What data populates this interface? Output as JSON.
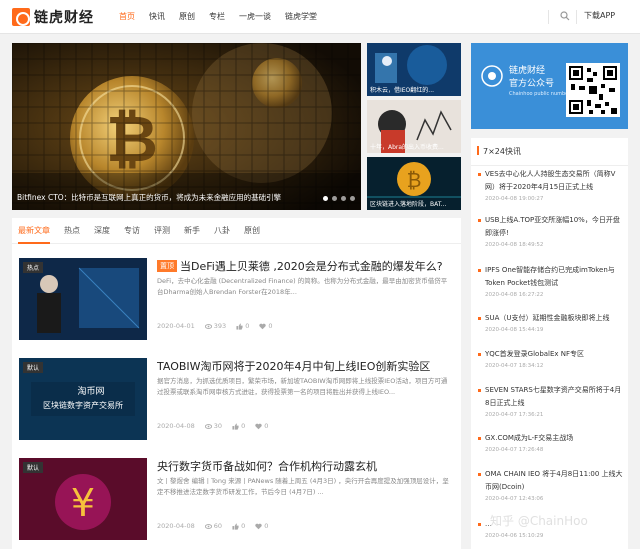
{
  "header": {
    "logo_text": "链虎财经",
    "nav": [
      "首页",
      "快讯",
      "原创",
      "专栏",
      "一虎一谈",
      "链虎学堂"
    ],
    "active_index": 0,
    "app_label": "下载APP",
    "accent": "#ff6a1a"
  },
  "banner": {
    "caption": "Bitfinex CTO：比特币是互联网上真正的货币，将成为未来金融应用的基础引擎",
    "dot_count": 4,
    "active_dot": 0
  },
  "thumbs": [
    {
      "caption": "积木云，借IEO翻红的..."
    },
    {
      "caption": "十年，Abra的出入币收费..."
    },
    {
      "caption": "区块链进入落地阶段，BAT..."
    }
  ],
  "tabs": [
    "最新文章",
    "热点",
    "深度",
    "专访",
    "评测",
    "新手",
    "八卦",
    "原创"
  ],
  "articles": [
    {
      "tag": "热点",
      "hot": "置顶",
      "title": "当DeFi遇上贝莱德 ,2020会是分布式金融的爆发年么?",
      "desc": "DeFi，去中心化金融 (Decentralized Finance) 的简称。也称为分布式金融，最早由加密货币借贷平台Dharma创始人Brendan Forster在2018年...",
      "date": "2020-04-01",
      "views": "393",
      "likes": "0",
      "favs": "0"
    },
    {
      "tag": "默认",
      "hot": "",
      "title": "TAOBIW淘币网将于2020年4月中旬上线IEO创新实验区",
      "desc": "据官方消息，为抓选优质项目，繁荣市场，新加坡TAOBIW淘币网即将上线投票IEO活动，项目方可通过投票或联系淘币网审核方式进驻，获得投票第一名的项目将胜出并获得上线IEO...",
      "date": "2020-04-08",
      "views": "30",
      "likes": "0",
      "favs": "0"
    },
    {
      "tag": "默认",
      "hot": "",
      "title": "央行数字货币备战如何？合作机构行动露玄机",
      "desc": "文丨黎煜舍  编辑丨Tong 来源丨PANews 随着上周五 (4月3日) ，央行开会再度提及加强顶层设计，坚定不移推进法定数字货币研发工作，节后今日 (4月7日) ...",
      "date": "2020-04-08",
      "views": "60",
      "likes": "0",
      "favs": "0"
    }
  ],
  "qr": {
    "line1": "链虎财经",
    "line2": "官方公众号",
    "line3": "Chainhoo public number"
  },
  "news": {
    "heading": "7×24快讯",
    "items": [
      {
        "text": "VES去中心化人人持股生态交易所（简称V网）将于2020年4月15日正式上线",
        "time": "2020-04-08 19:00:27"
      },
      {
        "text": "USB上线A.TOP亚交所涨幅10%，今日开盘即涨停!",
        "time": "2020-04-08 18:49:52"
      },
      {
        "text": "IPFS One智能存储合约已完成imToken与Token Pocket钱包测试",
        "time": "2020-04-08 16:27:22"
      },
      {
        "text": "SUA（U支付）延期性金融板块即将上线",
        "time": "2020-04-08 15:44:19"
      },
      {
        "text": "YQC首发登录GlobalEx NF专区",
        "time": "2020-04-07 18:34:12"
      },
      {
        "text": "SEVEN STARS七星数字资产交易所将于4月8日正式上线",
        "time": "2020-04-07 17:36:21"
      },
      {
        "text": "GX.COM成为L-F交易主战场",
        "time": "2020-04-07 17:26:48"
      },
      {
        "text": "OMA CHAIN IEO 将于4月8日11:00 上线大币网(Dcoin)",
        "time": "2020-04-07 12:43:06"
      },
      {
        "text": "...",
        "time": "2020-04-06 15:10:29"
      }
    ]
  },
  "watermark": "知乎 @ChainHoo"
}
